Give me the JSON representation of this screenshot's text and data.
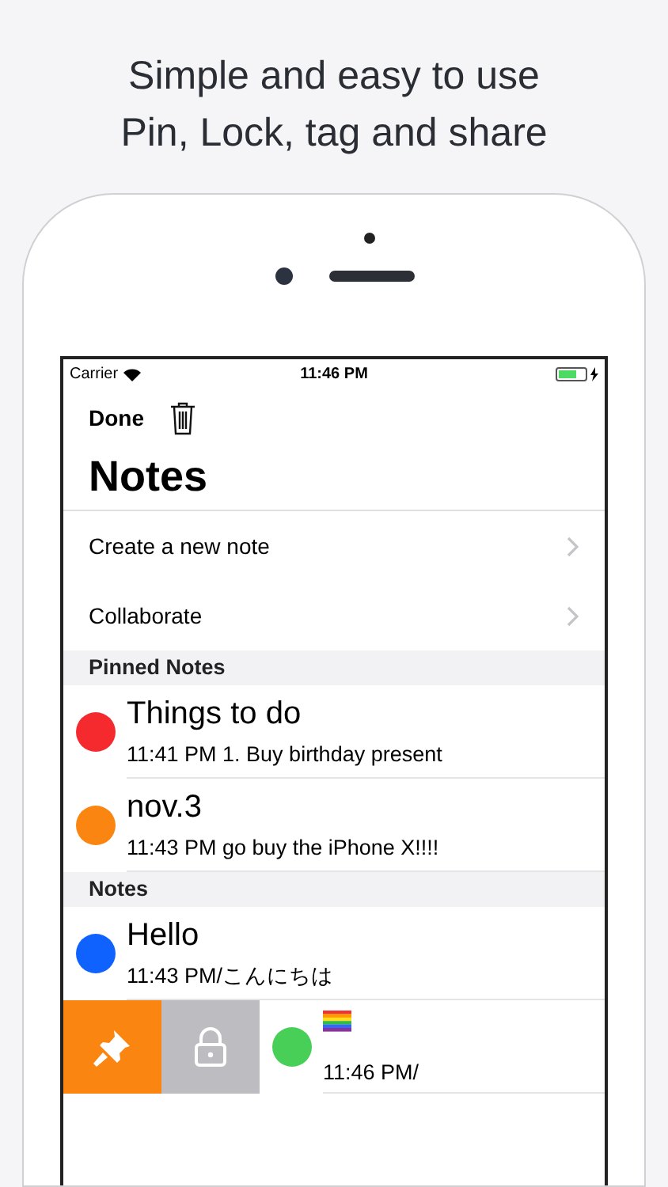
{
  "headline": [
    "Simple and easy to use",
    "Pin, Lock, tag and share"
  ],
  "status_bar": {
    "carrier": "Carrier",
    "time": "11:46 PM",
    "battery": {
      "level": 0.7
    }
  },
  "nav": {
    "done": "Done",
    "title": "Notes"
  },
  "menu": [
    {
      "label": "Create a new note"
    },
    {
      "label": "Collaborate"
    }
  ],
  "sections": [
    {
      "header": "Pinned Notes",
      "notes": [
        {
          "kind": "text",
          "title": "Things to do",
          "subtitle": "11:41 PM 1. Buy birthday present",
          "color": "#f52a2f",
          "swiped": false
        },
        {
          "kind": "text",
          "title": "nov.3",
          "subtitle": "11:43 PM go buy the iPhone X!!!!",
          "color": "#fa8511",
          "swiped": false
        }
      ]
    },
    {
      "header": "Notes",
      "notes": [
        {
          "kind": "text",
          "title": "Hello",
          "subtitle": "11:43 PM/こんにちは",
          "color": "#0f62fe",
          "swiped": false
        },
        {
          "kind": "flag",
          "subtitle": "11:46 PM/",
          "color": "#47cf58",
          "swiped": true
        }
      ]
    }
  ],
  "swipe_actions": [
    {
      "kind": "pin"
    },
    {
      "kind": "lock"
    }
  ]
}
